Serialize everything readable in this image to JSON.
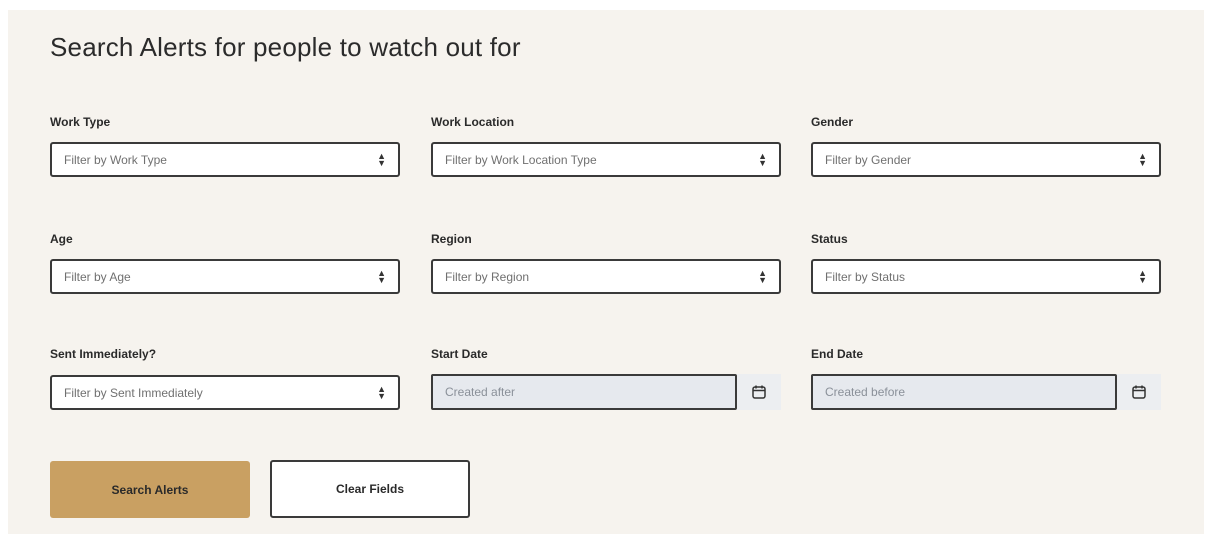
{
  "page": {
    "title": "Search Alerts for people to watch out for"
  },
  "filters": {
    "work_type": {
      "label": "Work Type",
      "placeholder": "Filter by Work Type"
    },
    "work_location": {
      "label": "Work Location",
      "placeholder": "Filter by Work Location Type"
    },
    "gender": {
      "label": "Gender",
      "placeholder": "Filter by Gender"
    },
    "age": {
      "label": "Age",
      "placeholder": "Filter by Age"
    },
    "region": {
      "label": "Region",
      "placeholder": "Filter by Region"
    },
    "status": {
      "label": "Status",
      "placeholder": "Filter by Status"
    },
    "sent_immediately": {
      "label": "Sent Immediately?",
      "placeholder": "Filter by Sent Immediately"
    },
    "start_date": {
      "label": "Start Date",
      "placeholder": "Created after"
    },
    "end_date": {
      "label": "End Date",
      "placeholder": "Created before"
    }
  },
  "actions": {
    "search_label": "Search Alerts",
    "clear_label": "Clear Fields"
  },
  "colors": {
    "primary_button": "#c9a062",
    "panel_background": "#f6f3ee",
    "date_input_background": "#e6e9ee"
  },
  "icons": {
    "select_arrow": "select-arrows-icon",
    "date_picker": "calendar-icon"
  }
}
